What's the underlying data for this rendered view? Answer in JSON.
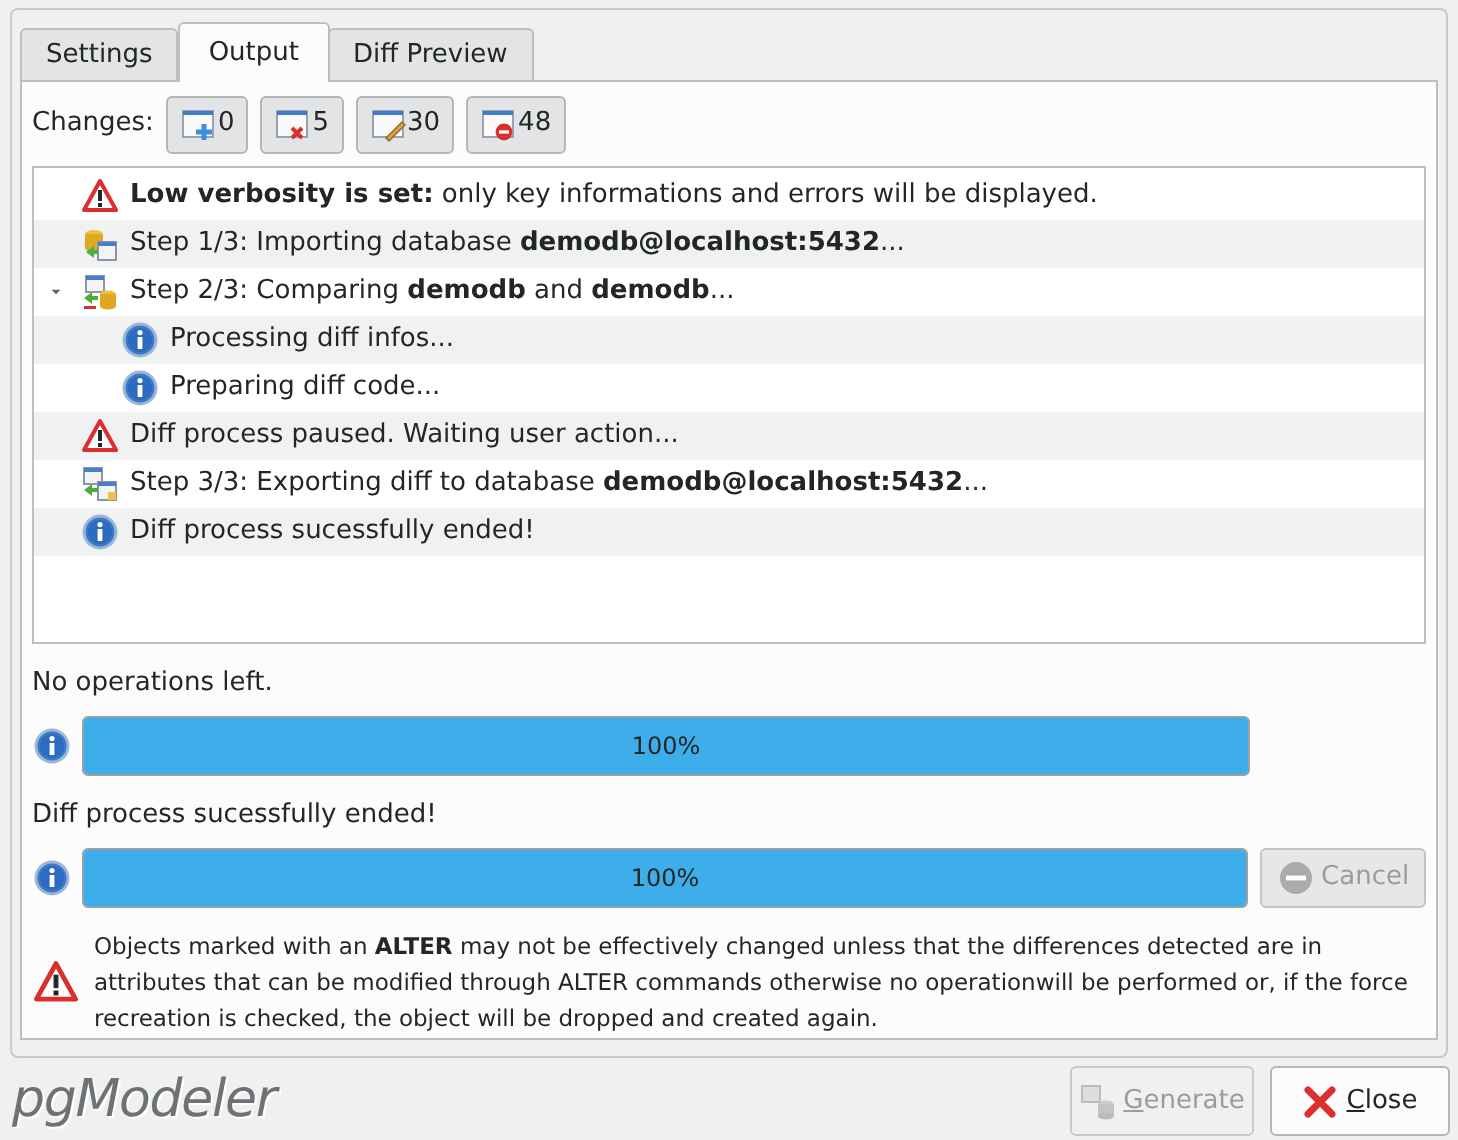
{
  "tabs": [
    {
      "label": "Settings",
      "selected": false
    },
    {
      "label": "Output",
      "selected": true
    },
    {
      "label": "Diff Preview",
      "selected": false
    }
  ],
  "changes": {
    "label": "Changes:",
    "buttons": [
      {
        "kind": "create",
        "count": "0"
      },
      {
        "kind": "drop",
        "count": "5"
      },
      {
        "kind": "alter",
        "count": "30"
      },
      {
        "kind": "recreate",
        "count": "48"
      }
    ]
  },
  "output": [
    {
      "kind": "warning",
      "text": "**Low verbosity is set:** only key informations and errors will be displayed."
    },
    {
      "kind": "import",
      "text": "Step 1/3: Importing database **demodb@localhost:5432**..."
    },
    {
      "kind": "compare",
      "text": "Step 2/3: Comparing **demodb** and **demodb**...",
      "expanded": true,
      "children": [
        {
          "kind": "info",
          "text": "Processing diff infos..."
        },
        {
          "kind": "info",
          "text": "Preparing diff code..."
        }
      ]
    },
    {
      "kind": "warning",
      "text": "Diff process paused. Waiting user action..."
    },
    {
      "kind": "export",
      "text": "Step 3/3: Exporting diff to database **demodb@localhost:5432**..."
    },
    {
      "kind": "info",
      "text": "Diff process sucessfully ended!"
    }
  ],
  "progress": [
    {
      "label": "No operations left.",
      "level": 1,
      "reading": "100%"
    },
    {
      "label": "Diff process sucessfully ended!",
      "level": 1,
      "reading": "100%",
      "cancel": {
        "label": "Cancel",
        "disabled": true
      }
    }
  ],
  "note": "Objects marked with an **ALTER** may not be effectively changed unless that the differences detected are in attributes that can be modified through ALTER commands otherwise no operationwill be performed or, if the force recreation is checked, the object will be dropped and created again.",
  "logo": "pgModeler",
  "buttons": [
    {
      "kind": "generate",
      "label": "Generate",
      "disabled": true,
      "mnemonic": true
    },
    {
      "kind": "close",
      "label": "Close",
      "disabled": false,
      "mnemonic": true
    }
  ]
}
